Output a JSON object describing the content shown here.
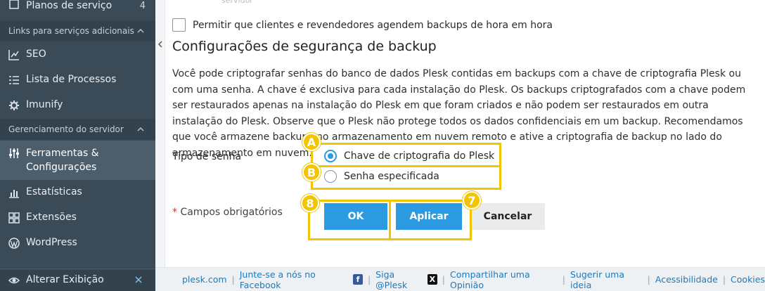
{
  "sidebar": {
    "top_item": {
      "label": "Planos de serviço",
      "count": "4"
    },
    "section_links": "Links para serviços adicionais",
    "links_items": [
      {
        "label": "SEO",
        "icon": "chart-line-icon"
      },
      {
        "label": "Lista de Processos",
        "icon": "list-icon"
      },
      {
        "label": "Imunify",
        "icon": "gear-icon"
      }
    ],
    "section_server": "Gerenciamento do servidor",
    "server_items": [
      {
        "label": "Ferramentas & Configurações",
        "line1": "Ferramentas &",
        "line2": "Configurações",
        "icon": "sliders-icon"
      },
      {
        "label": "Estatísticas",
        "icon": "bar-chart-icon"
      },
      {
        "label": "Extensões",
        "icon": "grid-icon"
      },
      {
        "label": "WordPress",
        "icon": "wordpress-icon"
      }
    ],
    "bottom": {
      "label": "Alterar Exibição"
    }
  },
  "main": {
    "faded_top": "servidor",
    "checkbox_label": "Permitir que clientes e revendedores agendem backups de hora em hora",
    "section_title": "Configurações de segurança de backup",
    "description": "Você pode criptografar senhas do banco de dados Plesk contidas em backups com a chave de criptografia Plesk ou com uma senha. A chave é exclusiva para cada instalação do Plesk. Os backups criptografados com a chave podem ser restaurados apenas na instalação do Plesk em que foram criados e não podem ser restaurados em outra instalação do Plesk. Observe que o Plesk não protege todos os dados confidenciais em um backup. Recomendamos que você armazene backups no armazenamento em nuvem remoto e ative a criptografia de backup no lado do armazenamento em nuvem.",
    "password_type_label": "Tipo de senha",
    "radio_options": [
      {
        "label": "Chave de criptografia do Plesk",
        "selected": true
      },
      {
        "label": "Senha especificada",
        "selected": false
      }
    ],
    "required_star": "*",
    "required_text": "Campos obrigatórios",
    "buttons": {
      "ok": "OK",
      "apply": "Aplicar",
      "cancel": "Cancelar"
    }
  },
  "annotations": {
    "a": "A",
    "b": "B",
    "ok": "8",
    "apply": "7",
    "color": "#f2c500"
  },
  "footer": {
    "links": [
      "plesk.com",
      "Junte-se a nós no Facebook",
      "Siga @Plesk",
      "Compartilhar uma Opinião",
      "Sugerir uma ideia",
      "Acessibilidade",
      "Cookies"
    ]
  },
  "colors": {
    "sidebar": "#3b4a57",
    "primary": "#2b9ae0",
    "footer_link": "#1f79b8"
  }
}
